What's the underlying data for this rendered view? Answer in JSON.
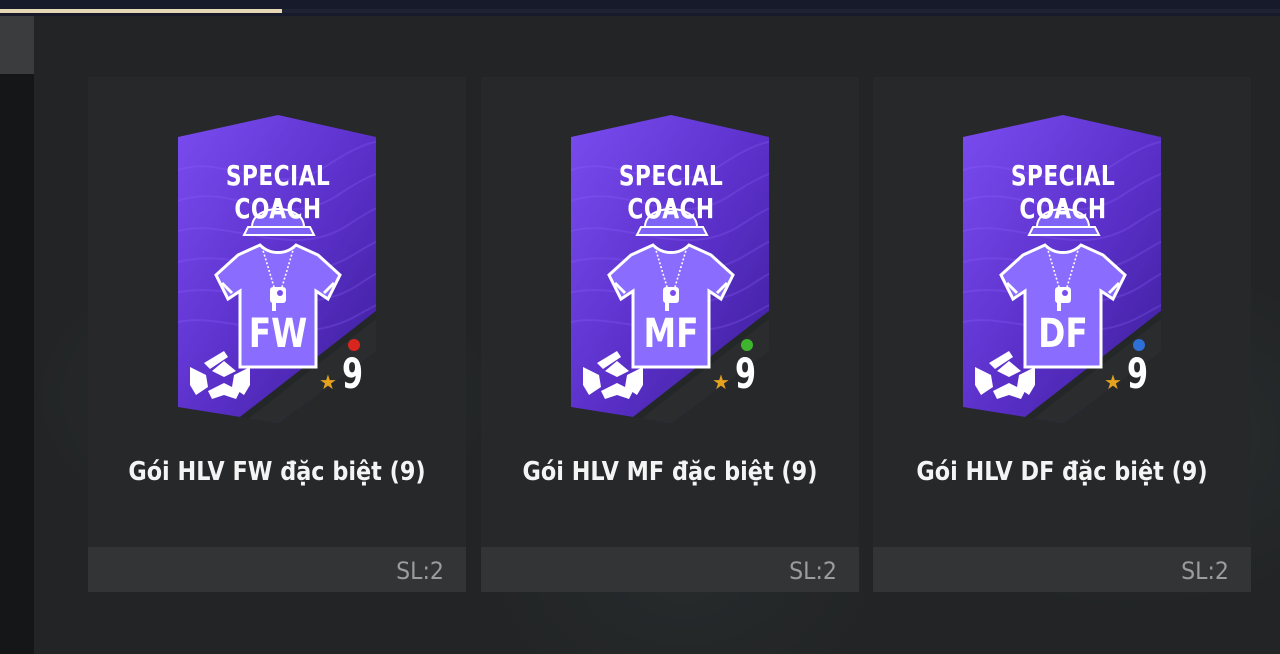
{
  "progress": 0.22,
  "colors": {
    "pack_purple": "#5a2fc8",
    "pack_purple_light": "#7a4cf0",
    "shirt": "#8a6cff",
    "star": "#e4a21e"
  },
  "cards": [
    {
      "brand": "SPECIAL COACH",
      "cap_letter": "C",
      "position": "FW",
      "grade": "9",
      "dot_color": "#d8261f",
      "title": "Gói HLV FW đặc biệt (9)",
      "quantity": "SL:2",
      "icons": [
        "coach-emblem-icon",
        "star-icon"
      ]
    },
    {
      "brand": "SPECIAL COACH",
      "cap_letter": "C",
      "position": "MF",
      "grade": "9",
      "dot_color": "#3fb42e",
      "title": "Gói HLV MF đặc biệt (9)",
      "quantity": "SL:2",
      "icons": [
        "coach-emblem-icon",
        "star-icon"
      ]
    },
    {
      "brand": "SPECIAL COACH",
      "cap_letter": "C",
      "position": "DF",
      "grade": "9",
      "dot_color": "#2f6fd8",
      "title": "Gói HLV DF đặc biệt (9)",
      "quantity": "SL:2",
      "icons": [
        "coach-emblem-icon",
        "star-icon"
      ]
    }
  ]
}
